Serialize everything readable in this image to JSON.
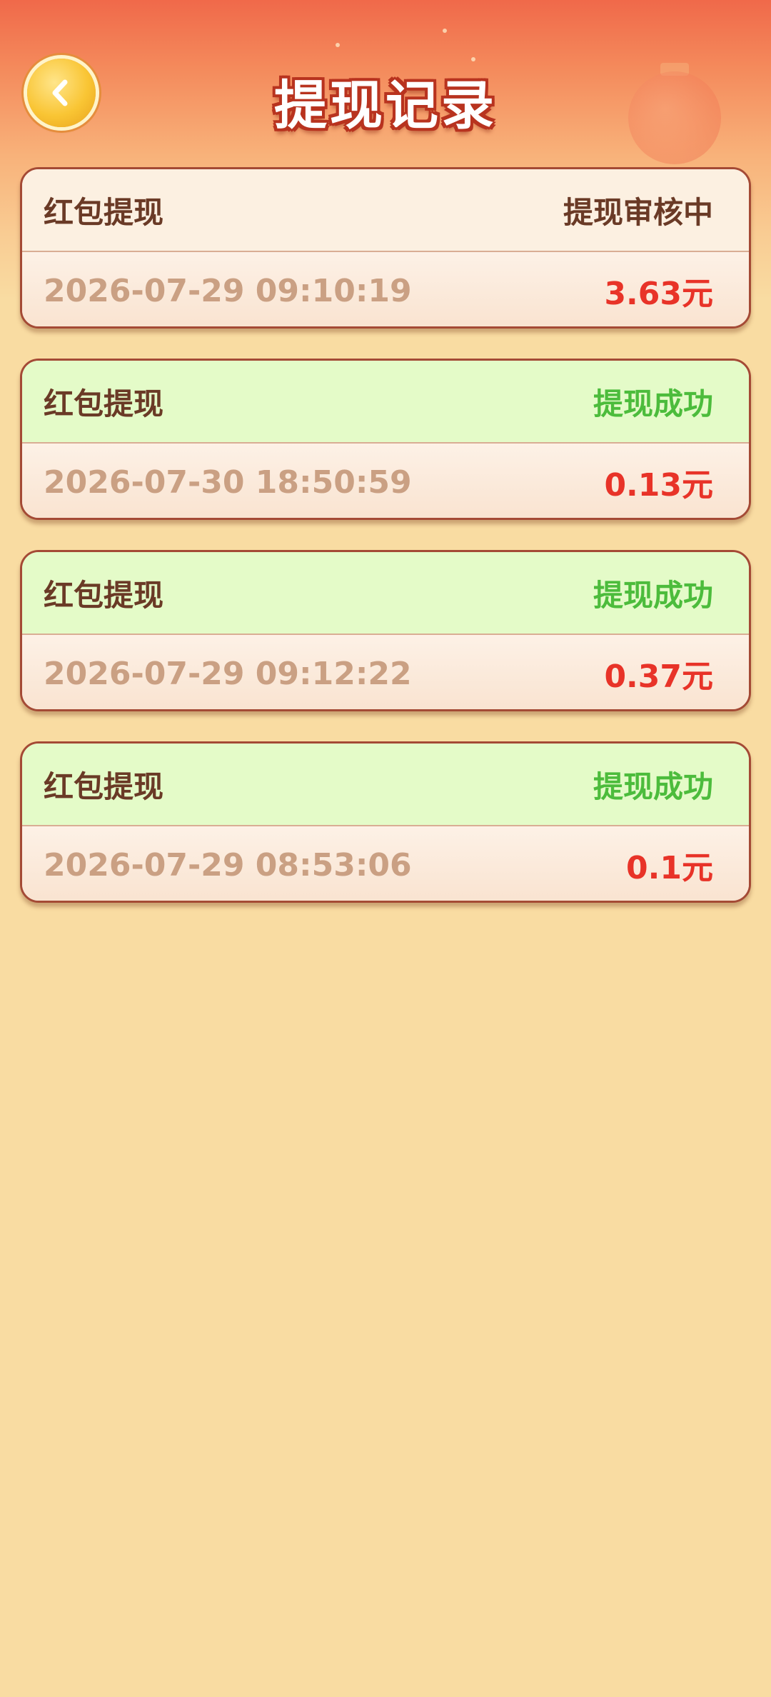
{
  "header": {
    "title": "提现记录",
    "back_icon": "chevron-left-icon"
  },
  "colors": {
    "accent_red": "#e83328",
    "success_green": "#4cbc3c",
    "text_brown": "#6a3a26",
    "time_tan": "#caa083",
    "page_bg": "#f9dca2"
  },
  "records": [
    {
      "type": "红包提现",
      "status": "提现审核中",
      "status_kind": "pending",
      "time": "2026-07-29 09:10:19",
      "amount": "3.63元"
    },
    {
      "type": "红包提现",
      "status": "提现成功",
      "status_kind": "success",
      "time": "2026-07-30 18:50:59",
      "amount": "0.13元"
    },
    {
      "type": "红包提现",
      "status": "提现成功",
      "status_kind": "success",
      "time": "2026-07-29 09:12:22",
      "amount": "0.37元"
    },
    {
      "type": "红包提现",
      "status": "提现成功",
      "status_kind": "success",
      "time": "2026-07-29 08:53:06",
      "amount": "0.1元"
    }
  ]
}
